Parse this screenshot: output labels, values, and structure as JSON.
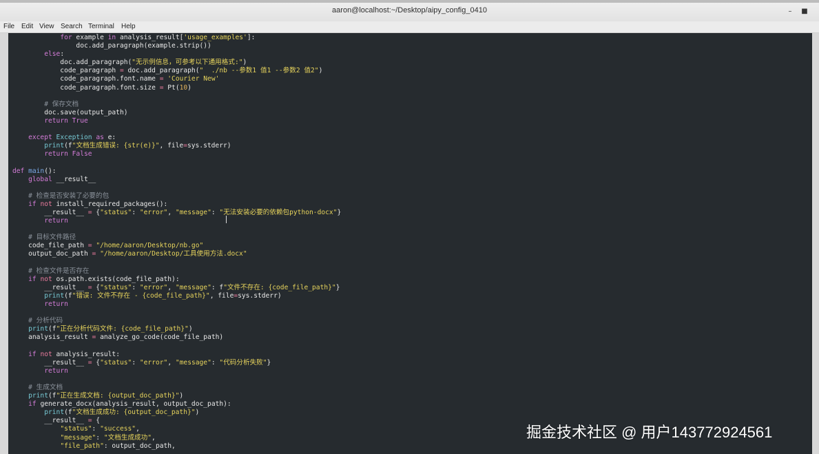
{
  "window": {
    "title": "aaron@localhost:~/Desktop/aipy_config_0410",
    "controls": [
      "minimize",
      "maximize"
    ]
  },
  "menu": [
    "File",
    "Edit",
    "View",
    "Search",
    "Terminal",
    "Help"
  ],
  "code_lines": [
    [
      [
        "            "
      ],
      [
        "for",
        "kw"
      ],
      [
        " example "
      ],
      [
        "in",
        "kw"
      ],
      [
        " analysis_result["
      ],
      [
        "'usage_examples'",
        "st"
      ],
      [
        "]:"
      ]
    ],
    [
      [
        "                doc.add_paragraph(example.strip())"
      ]
    ],
    [
      [
        "        "
      ],
      [
        "else",
        "kw"
      ],
      [
        ":"
      ]
    ],
    [
      [
        "            doc.add_paragraph("
      ],
      [
        "\"无示例信息，可参考以下通用格式:\"",
        "st"
      ],
      [
        ")"
      ]
    ],
    [
      [
        "            code_paragraph "
      ],
      [
        "=",
        "op"
      ],
      [
        " doc.add_paragraph("
      ],
      [
        "\"  ./nb --参数1 值1 --参数2 值2\"",
        "st"
      ],
      [
        ")"
      ]
    ],
    [
      [
        "            code_paragraph.font.name "
      ],
      [
        "=",
        "op"
      ],
      [
        " "
      ],
      [
        "'Courier New'",
        "st"
      ]
    ],
    [
      [
        "            code_paragraph.font.size "
      ],
      [
        "=",
        "op"
      ],
      [
        " Pt("
      ],
      [
        "10",
        "nm"
      ],
      [
        ")"
      ]
    ],
    [
      [
        ""
      ]
    ],
    [
      [
        "        "
      ],
      [
        "# 保存文档",
        "cm"
      ]
    ],
    [
      [
        "        doc.save(output_path)"
      ]
    ],
    [
      [
        "        "
      ],
      [
        "return",
        "kw"
      ],
      [
        " "
      ],
      [
        "True",
        "kw"
      ]
    ],
    [
      [
        ""
      ]
    ],
    [
      [
        "    "
      ],
      [
        "except",
        "kw"
      ],
      [
        " "
      ],
      [
        "Exception",
        "bi"
      ],
      [
        " "
      ],
      [
        "as",
        "kw"
      ],
      [
        " e:"
      ]
    ],
    [
      [
        "        "
      ],
      [
        "print",
        "bi"
      ],
      [
        "(f"
      ],
      [
        "\"文档生成错误: {str(e)}\"",
        "st"
      ],
      [
        ", file"
      ],
      [
        "=",
        "op"
      ],
      [
        "sys.stderr)"
      ]
    ],
    [
      [
        "        "
      ],
      [
        "return",
        "kw"
      ],
      [
        " "
      ],
      [
        "False",
        "kw"
      ]
    ],
    [
      [
        ""
      ]
    ],
    [
      [
        "def",
        "kw"
      ],
      [
        " "
      ],
      [
        "main",
        "fn"
      ],
      [
        "():"
      ]
    ],
    [
      [
        "    "
      ],
      [
        "global",
        "kw"
      ],
      [
        " __result__"
      ]
    ],
    [
      [
        ""
      ]
    ],
    [
      [
        "    "
      ],
      [
        "# 检查是否安装了必要的包",
        "cm"
      ]
    ],
    [
      [
        "    "
      ],
      [
        "if",
        "kw"
      ],
      [
        " "
      ],
      [
        "not",
        "op"
      ],
      [
        " install_required_packages():"
      ]
    ],
    [
      [
        "        __result__ "
      ],
      [
        "=",
        "op"
      ],
      [
        " {"
      ],
      [
        "\"status\"",
        "st"
      ],
      [
        ": "
      ],
      [
        "\"error\"",
        "st"
      ],
      [
        ", "
      ],
      [
        "\"message\"",
        "st"
      ],
      [
        ": "
      ],
      [
        "\"无法安装必要的依赖包python-docx\"",
        "st"
      ],
      [
        "}"
      ]
    ],
    [
      [
        "        "
      ],
      [
        "return",
        "kw"
      ]
    ],
    [
      [
        ""
      ]
    ],
    [
      [
        "    "
      ],
      [
        "# 目标文件路径",
        "cm"
      ]
    ],
    [
      [
        "    code_file_path "
      ],
      [
        "=",
        "op"
      ],
      [
        " "
      ],
      [
        "\"/home/aaron/Desktop/nb.go\"",
        "st"
      ]
    ],
    [
      [
        "    output_doc_path "
      ],
      [
        "=",
        "op"
      ],
      [
        " "
      ],
      [
        "\"/home/aaron/Desktop/工具使用方法.docx\"",
        "st"
      ]
    ],
    [
      [
        ""
      ]
    ],
    [
      [
        "    "
      ],
      [
        "# 检查文件是否存在",
        "cm"
      ]
    ],
    [
      [
        "    "
      ],
      [
        "if",
        "kw"
      ],
      [
        " "
      ],
      [
        "not",
        "op"
      ],
      [
        " os.path.exists(code_file_path):"
      ]
    ],
    [
      [
        "        __result__ "
      ],
      [
        "=",
        "op"
      ],
      [
        " {"
      ],
      [
        "\"status\"",
        "st"
      ],
      [
        ": "
      ],
      [
        "\"error\"",
        "st"
      ],
      [
        ", "
      ],
      [
        "\"message\"",
        "st"
      ],
      [
        ": f"
      ],
      [
        "\"文件不存在: {code_file_path}\"",
        "st"
      ],
      [
        "}"
      ]
    ],
    [
      [
        "        "
      ],
      [
        "print",
        "bi"
      ],
      [
        "(f"
      ],
      [
        "\"错误: 文件不存在 - {code_file_path}\"",
        "st"
      ],
      [
        ", file"
      ],
      [
        "=",
        "op"
      ],
      [
        "sys.stderr)"
      ]
    ],
    [
      [
        "        "
      ],
      [
        "return",
        "kw"
      ]
    ],
    [
      [
        ""
      ]
    ],
    [
      [
        "    "
      ],
      [
        "# 分析代码",
        "cm"
      ]
    ],
    [
      [
        "    "
      ],
      [
        "print",
        "bi"
      ],
      [
        "(f"
      ],
      [
        "\"正在分析代码文件: {code_file_path}\"",
        "st"
      ],
      [
        ")"
      ]
    ],
    [
      [
        "    analysis_result "
      ],
      [
        "=",
        "op"
      ],
      [
        " analyze_go_code(code_file_path)"
      ]
    ],
    [
      [
        ""
      ]
    ],
    [
      [
        "    "
      ],
      [
        "if",
        "kw"
      ],
      [
        " "
      ],
      [
        "not",
        "op"
      ],
      [
        " analysis_result:"
      ]
    ],
    [
      [
        "        __result__ "
      ],
      [
        "=",
        "op"
      ],
      [
        " {"
      ],
      [
        "\"status\"",
        "st"
      ],
      [
        ": "
      ],
      [
        "\"error\"",
        "st"
      ],
      [
        ", "
      ],
      [
        "\"message\"",
        "st"
      ],
      [
        ": "
      ],
      [
        "\"代码分析失败\"",
        "st"
      ],
      [
        "}"
      ]
    ],
    [
      [
        "        "
      ],
      [
        "return",
        "kw"
      ]
    ],
    [
      [
        ""
      ]
    ],
    [
      [
        "    "
      ],
      [
        "# 生成文档",
        "cm"
      ]
    ],
    [
      [
        "    "
      ],
      [
        "print",
        "bi"
      ],
      [
        "(f"
      ],
      [
        "\"正在生成文档: {output_doc_path}\"",
        "st"
      ],
      [
        ")"
      ]
    ],
    [
      [
        "    "
      ],
      [
        "if",
        "kw"
      ],
      [
        " generate_docx(analysis_result, output_doc_path):"
      ]
    ],
    [
      [
        "        "
      ],
      [
        "print",
        "bi"
      ],
      [
        "(f"
      ],
      [
        "\"文档生成成功: {output_doc_path}\"",
        "st"
      ],
      [
        ")"
      ]
    ],
    [
      [
        "        __result__ "
      ],
      [
        "=",
        "op"
      ],
      [
        " {"
      ]
    ],
    [
      [
        "            "
      ],
      [
        "\"status\"",
        "st"
      ],
      [
        ": "
      ],
      [
        "\"success\"",
        "st"
      ],
      [
        ","
      ]
    ],
    [
      [
        "            "
      ],
      [
        "\"message\"",
        "st"
      ],
      [
        ": "
      ],
      [
        "\"文档生成成功\"",
        "st"
      ],
      [
        ","
      ]
    ],
    [
      [
        "            "
      ],
      [
        "\"file_path\"",
        "st"
      ],
      [
        ": output_doc_path,"
      ]
    ]
  ],
  "watermark": "掘金技术社区 @ 用户143772924561"
}
